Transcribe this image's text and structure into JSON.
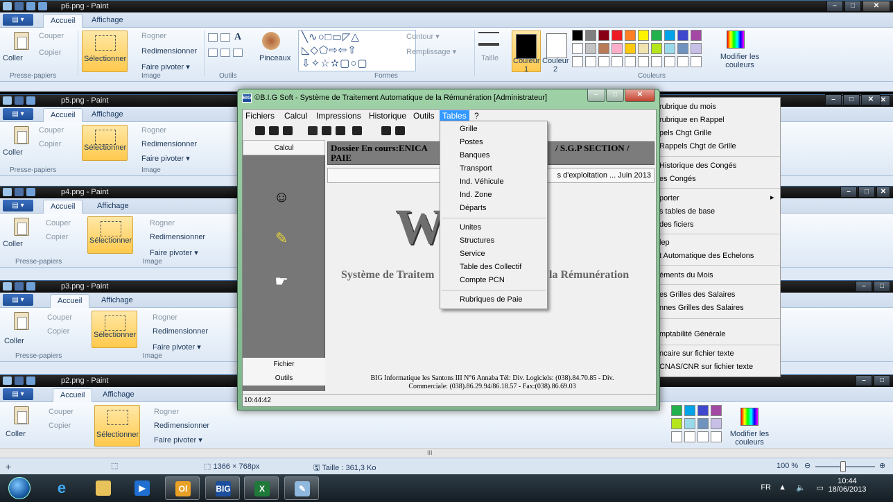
{
  "paint_windows": [
    {
      "title": "p6.png - Paint"
    },
    {
      "title": "p5.png - Paint"
    },
    {
      "title": "p4.png - Paint"
    },
    {
      "title": "p3.png - Paint"
    },
    {
      "title": "p2.png - Paint"
    }
  ],
  "paint_ui": {
    "tabs": [
      "Accueil",
      "Affichage"
    ],
    "coller": "Coller",
    "couper": "Couper",
    "copier": "Copier",
    "selectionner": "Sélectionner",
    "rogner": "Rogner",
    "redimensionner": "Redimensionner",
    "faire_pivoter": "Faire pivoter ▾",
    "pinceaux": "Pinceaux",
    "contour": "Contour ▾",
    "remplissage": "Remplissage ▾",
    "taille": "Taille",
    "couleur1": "Couleur",
    "couleur1_num": "1",
    "couleur2": "Couleur",
    "couleur2_num": "2",
    "modifier_couleurs": "Modifier les couleurs",
    "groups": {
      "presse": "Presse-papiers",
      "image": "Image",
      "outils": "Outils",
      "formes": "Formes",
      "couleurs": "Couleurs"
    }
  },
  "app": {
    "title": "©B.I.G Soft - Système de Traitement Automatique de la Rémunération  [Administrateur]",
    "logo_text": "BIG",
    "menu": [
      "Fichiers",
      "Calcul",
      "Impressions",
      "Historique",
      "Outils",
      "Tables",
      "?"
    ],
    "left_top": "Calcul",
    "left_fichier": "Fichier",
    "left_outils": "Outils",
    "dossier": "Dossier En cours:ENICAB / S.G.P SECTION / PAIE",
    "dossier_line1a": "Dossier En cours:ENICA",
    "dossier_line1b": "/ S.G.P SECTION /",
    "dossier_line2": "PAIE",
    "info": "s d'exploitation ... Juin 2013",
    "logo_letters": "W",
    "slogan_left": "Système de Traitem",
    "slogan_right": "la Rémunération",
    "address_line1": "BIG Informatique les Santons III N°6 Annaba Tél: Div. Logiciels: (038).84.70.85 - Div.",
    "address_line2": "Commerciale: (038).86.29.94/86.18.57 - Fax:(038).86.69.03",
    "status_time": "10:44:42"
  },
  "tables_menu": {
    "group1": [
      "Grille",
      "Postes",
      "Banques",
      "Transport",
      "Ind. Véhicule",
      "Ind. Zone",
      "Départs"
    ],
    "group2": [
      "Unites",
      "Structures",
      "Service",
      "Table des Collectif",
      "Compte PCN"
    ],
    "group3": [
      "Rubriques de Paie"
    ]
  },
  "context_menu": {
    "items": [
      "rubrique du mois",
      "rubrique en Rappel",
      "pels Chgt Grille",
      "Rappels Chgt de Grille",
      "Historique des Congés",
      "es Congés",
      "porter",
      "s tables de base",
      "des ficiers",
      "lep",
      "t Automatique des Echelons",
      "éments du Mois",
      "es Grilles des Salaires",
      "nnes Grilles des Salaires",
      "mptabilité Générale",
      "ncaire sur fichier texte",
      "CNAS/CNR sur fichier texte"
    ],
    "submenu_arrow": "▸"
  },
  "paint_status": {
    "dims": "1366 × 768px",
    "size": "Taille : 361,3 Ko",
    "zoom": "100 %"
  },
  "taskbar": {
    "lang": "FR",
    "time": "10:44",
    "date": "18/06/2013"
  },
  "colors": {
    "accent_orange": "#ffc94d",
    "app_frame": "#8fc39a",
    "menu_highlight": "#3399ff"
  }
}
